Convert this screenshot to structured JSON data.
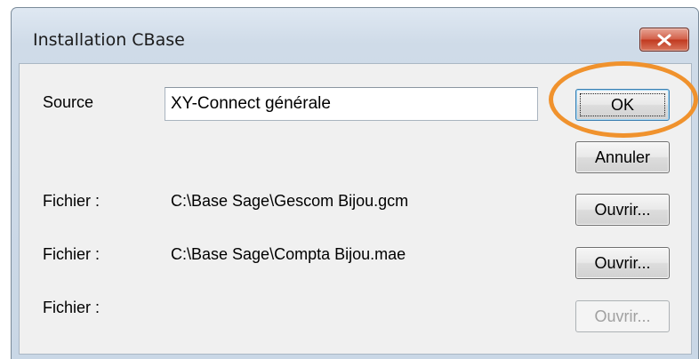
{
  "window": {
    "title": "Installation CBase",
    "close_icon": "close-icon"
  },
  "form": {
    "source_label": "Source",
    "source_value": "XY-Connect générale",
    "file_label": "Fichier :",
    "files": [
      {
        "path": "C:\\Base Sage\\Gescom Bijou.gcm",
        "button": "Ouvrir...",
        "enabled": true
      },
      {
        "path": "C:\\Base Sage\\Compta Bijou.mae",
        "button": "Ouvrir...",
        "enabled": true
      },
      {
        "path": "",
        "button": "Ouvrir...",
        "enabled": false
      }
    ]
  },
  "buttons": {
    "ok": "OK",
    "cancel": "Annuler"
  },
  "colors": {
    "highlight_ring": "#f0922d",
    "close_button": "#c7432a",
    "client_background": "#f0f0f0"
  }
}
